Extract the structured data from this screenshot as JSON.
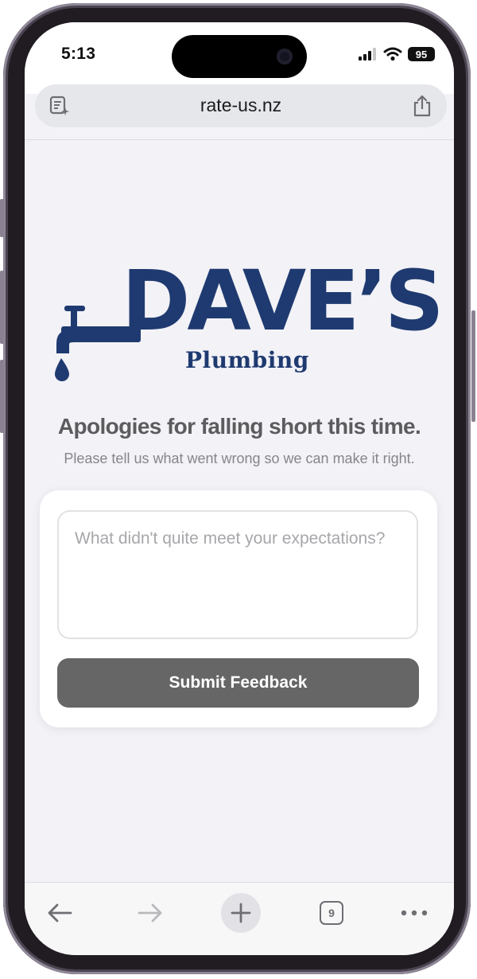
{
  "status_bar": {
    "time": "5:13",
    "battery": "95"
  },
  "browser": {
    "url": "rate-us.nz",
    "tab_count": "9"
  },
  "logo": {
    "title": "DAVE’S",
    "subtitle": "Plumbing"
  },
  "page": {
    "headline": "Apologies for falling short this time.",
    "subtext": "Please tell us what went wrong so we can make it right."
  },
  "form": {
    "feedback_placeholder": "What didn't quite meet your expectations?",
    "submit_label": "Submit Feedback"
  },
  "colors": {
    "brand_navy": "#1f3a70",
    "button_gray": "#666666",
    "page_bg": "#f2f2f7"
  },
  "icons": [
    "reader-icon",
    "share-icon",
    "back-arrow-icon",
    "forward-arrow-icon",
    "plus-icon",
    "tabs-icon",
    "more-icon",
    "signal-icon",
    "wifi-icon",
    "battery-icon",
    "faucet-icon"
  ]
}
